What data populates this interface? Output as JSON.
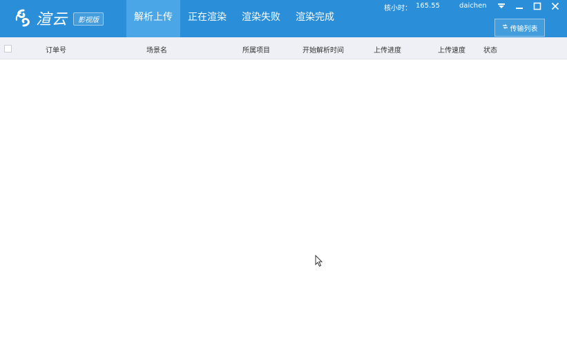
{
  "app": {
    "logo_text": "渲云",
    "edition_badge": "影视版"
  },
  "nav": {
    "tabs": [
      {
        "label": "解析上传",
        "active": true
      },
      {
        "label": "正在渲染",
        "active": false
      },
      {
        "label": "渲染失败",
        "active": false
      },
      {
        "label": "渲染完成",
        "active": false
      }
    ]
  },
  "account": {
    "hours_label": "核小时：",
    "hours_value": "165.55",
    "username": "daichen"
  },
  "toolbar": {
    "transfer_list_label": "传输列表"
  },
  "table": {
    "columns": [
      "订单号",
      "场景名",
      "所属项目",
      "开始解析时间",
      "上传进度",
      "上传速度",
      "状态"
    ],
    "rows": []
  },
  "colors": {
    "header_bg": "#2a8fd8",
    "active_tab_bg": "#4aa6e6",
    "table_header_bg": "#eef0f5"
  },
  "icons": {
    "logo": "swirl-logo-icon",
    "dropdown": "dropdown-arrow-icon",
    "minimize": "minimize-icon",
    "maximize": "maximize-icon",
    "close": "close-icon",
    "transfer": "transfer-icon",
    "cursor": "mouse-cursor-icon"
  }
}
